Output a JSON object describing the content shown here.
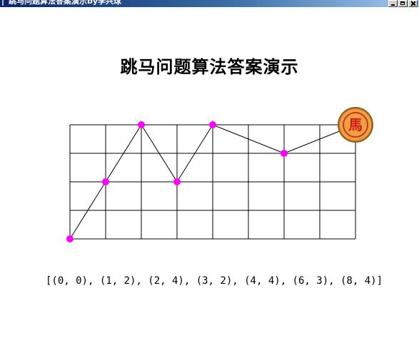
{
  "window": {
    "title": "跳马问题算法答案演示by李兴球",
    "icon": "app-icon"
  },
  "heading": "跳马问题算法答案演示",
  "board": {
    "cols": 8,
    "rows": 4,
    "line_color": "#000000",
    "path_color": "#000000",
    "point_color": "#ff00ff"
  },
  "path": [
    [
      0,
      0
    ],
    [
      1,
      2
    ],
    [
      2,
      4
    ],
    [
      3,
      2
    ],
    [
      4,
      4
    ],
    [
      6,
      3
    ],
    [
      8,
      4
    ]
  ],
  "path_text": "[(0, 0), (1, 2), (2, 4), (3, 2), (4, 4), (6, 3), (8, 4)]",
  "horse_piece": {
    "char": "馬",
    "fill": "#f0a040",
    "ring_color": "#c0392b",
    "text_color": "#d11a1a"
  }
}
